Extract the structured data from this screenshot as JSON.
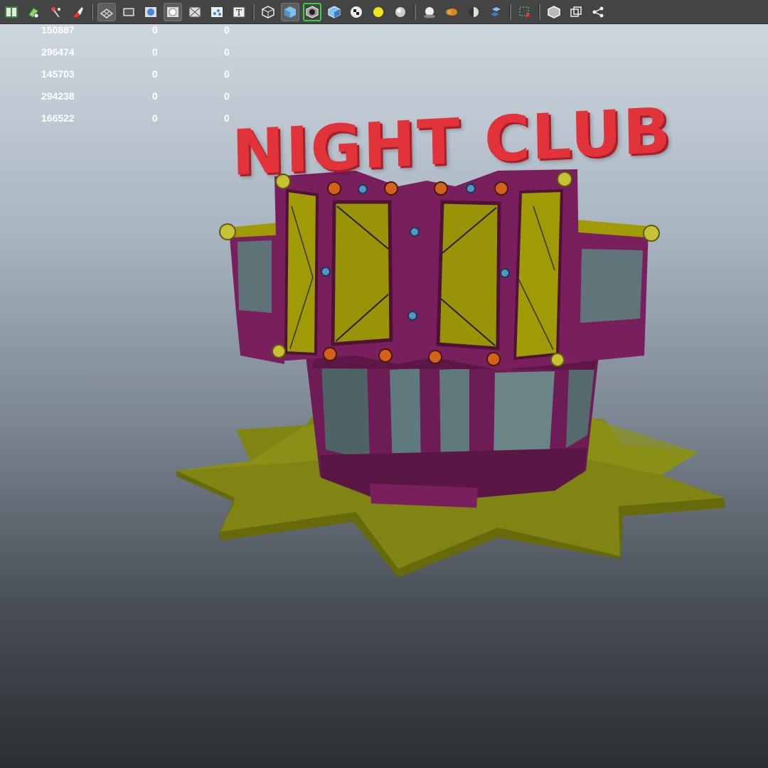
{
  "toolbar": {
    "buttons": [
      {
        "icon": "book-icon",
        "state": "normal"
      },
      {
        "icon": "camera-attributes-icon",
        "state": "normal"
      },
      {
        "icon": "bookmark-icon",
        "state": "normal"
      },
      {
        "icon": "brush-icon",
        "state": "normal"
      },
      "separator",
      {
        "icon": "grid-icon",
        "state": "active"
      },
      {
        "icon": "film-gate-icon",
        "state": "normal"
      },
      {
        "icon": "sphere-shaded-icon",
        "state": "normal"
      },
      {
        "icon": "resolution-gate-icon",
        "state": "active"
      },
      {
        "icon": "safe-area-icon",
        "state": "normal"
      },
      {
        "icon": "field-chart-icon",
        "state": "normal"
      },
      {
        "icon": "text-icon",
        "state": "normal"
      },
      "separator",
      {
        "icon": "wireframe-cube-icon",
        "state": "normal"
      },
      {
        "icon": "smooth-shade-cube-icon",
        "state": "active"
      },
      {
        "icon": "wireframe-on-shaded-icon",
        "state": "selected"
      },
      {
        "icon": "textured-cube-icon",
        "state": "normal"
      },
      {
        "icon": "checker-icon",
        "state": "normal"
      },
      {
        "icon": "light-icon",
        "state": "normal"
      },
      {
        "icon": "shadow-sphere-icon",
        "state": "normal"
      },
      "separator",
      {
        "icon": "ambient-occlusion-icon",
        "state": "normal"
      },
      {
        "icon": "motion-blur-icon",
        "state": "normal"
      },
      {
        "icon": "anti-alias-icon",
        "state": "normal"
      },
      {
        "icon": "depth-of-field-icon",
        "state": "normal"
      },
      "separator",
      {
        "icon": "isolate-select-icon",
        "state": "normal"
      },
      "separator",
      {
        "icon": "xray-icon",
        "state": "normal"
      },
      {
        "icon": "xray-joints-icon",
        "state": "normal"
      },
      {
        "icon": "share-icon",
        "state": "normal"
      }
    ]
  },
  "hud": {
    "rows": [
      [
        "150887",
        "0",
        "0"
      ],
      [
        "296474",
        "0",
        "0"
      ],
      [
        "145703",
        "0",
        "0"
      ],
      [
        "294238",
        "0",
        "0"
      ],
      [
        "166522",
        "0",
        "0"
      ]
    ]
  },
  "scene": {
    "sign_text": "NIGHT CLUB",
    "colors": {
      "sign_red": "#e2323a",
      "building_magenta": "#7a1f5e",
      "panel_yellow": "#a19a07",
      "glass_teal": "#5b7478",
      "base_olive": "#7f8412",
      "bulb_orange": "#d4621c",
      "bulb_yellow": "#c7c234",
      "bulb_blue": "#4a9ac8"
    }
  }
}
